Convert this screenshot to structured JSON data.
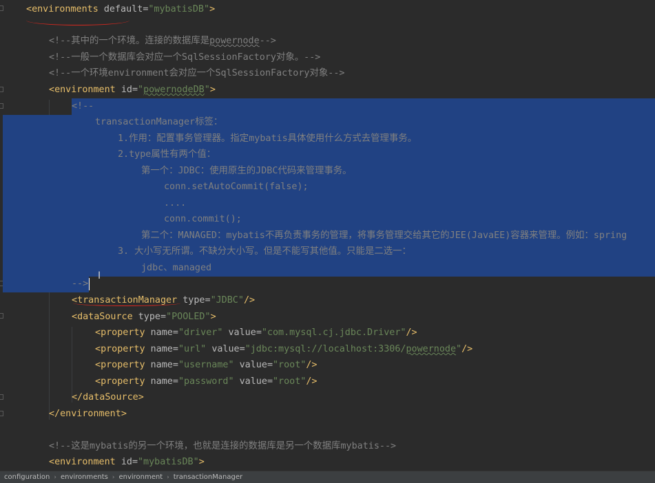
{
  "breadcrumbs": [
    "configuration",
    "environments",
    "environment",
    "transactionManager"
  ],
  "breadcrumb_separator": "›",
  "code": {
    "env_open": {
      "tag": "environments",
      "attr": "default",
      "val": "\"mybatisDB\""
    },
    "c1_pre": "<!--其中的一个环境。连接的数据库是",
    "c1_word": "powernode",
    "c1_post": "-->",
    "c2": "<!--一般一个数据库会对应一个SqlSessionFactory对象。-->",
    "c3": "<!--一个环境environment会对应一个SqlSessionFactory对象-->",
    "environment1": {
      "tag": "environment",
      "attr": "id",
      "val_pre": "\"",
      "val_word": "powernodeDB",
      "val_post": "\""
    },
    "block_comment": [
      "<!--",
      "transactionManager标签：",
      "1.作用：配置事务管理器。指定mybatis具体使用什么方式去管理事务。",
      "2.type属性有两个值：",
      "第一个：JDBC：使用原生的JDBC代码来管理事务。",
      "conn.setAutoCommit(false);",
      "....",
      "conn.commit();",
      "第二个：MANAGED：mybatis不再负责事务的管理，将事务管理交给其它的JEE(JavaEE)容器来管理。例如：spring",
      "3. 大小写无所谓。不缺分大小写。但是不能写其他值。只能是二选一：",
      "jdbc、managed",
      "-->"
    ],
    "tx_manager": {
      "tag": "transactionManager",
      "attr": "type",
      "val": "\"JDBC\""
    },
    "datasource": {
      "tag": "dataSource",
      "attr": "type",
      "val": "\"POOLED\""
    },
    "properties": [
      {
        "tag": "property",
        "name_attr": "name",
        "name_val": "\"driver\"",
        "value_attr": "value",
        "value_val": "\"com.mysql.cj.jdbc.Driver\""
      },
      {
        "tag": "property",
        "name_attr": "name",
        "name_val": "\"url\"",
        "value_attr": "value",
        "value_val_pre": "\"jdbc:mysql://localhost:3306/",
        "value_val_word": "powernode",
        "value_val_post": "\""
      },
      {
        "tag": "property",
        "name_attr": "name",
        "name_val": "\"username\"",
        "value_attr": "value",
        "value_val": "\"root\""
      },
      {
        "tag": "property",
        "name_attr": "name",
        "name_val": "\"password\"",
        "value_attr": "value",
        "value_val": "\"root\""
      }
    ],
    "datasource_close": "dataSource",
    "environment_close": "environment",
    "c4": "<!--这是mybatis的另一个环境，也就是连接的数据库是另一个数据库mybatis-->",
    "environment2": {
      "tag": "environment",
      "attr": "id",
      "val": "\"mybatisDB\""
    }
  },
  "colors": {
    "background": "#2b2b2b",
    "selection": "#214283",
    "tag": "#e8bf6a",
    "attribute": "#bababa",
    "string": "#6a8759",
    "comment": "#808080",
    "annotation_ink": "#d8281f"
  }
}
